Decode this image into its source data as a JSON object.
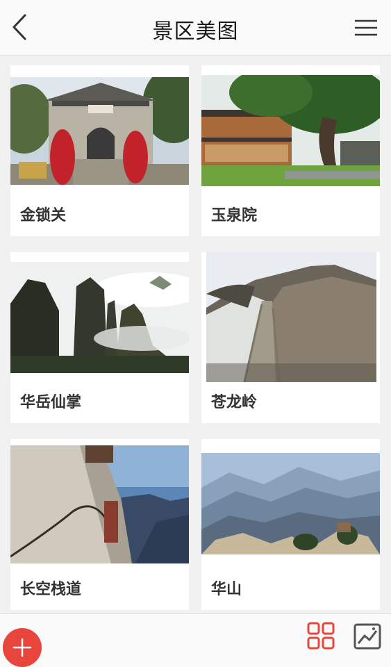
{
  "header": {
    "title": "景区美图",
    "back_icon": "chevron-left-icon",
    "menu_icon": "hamburger-menu-icon"
  },
  "gallery": {
    "items": [
      {
        "label": "金锁关",
        "image": "stone-gate-temple"
      },
      {
        "label": "玉泉院",
        "image": "temple-courtyard-with-pine"
      },
      {
        "label": "华岳仙掌",
        "image": "misty-mountain-peaks"
      },
      {
        "label": "苍龙岭",
        "image": "cliff-stone-stairway"
      },
      {
        "label": "长空栈道",
        "image": "cliffside-plank-walkway"
      },
      {
        "label": "华山",
        "image": "mountain-range-vista"
      }
    ]
  },
  "footer": {
    "add_icon": "plus-icon",
    "grid_view_icon": "grid-view-icon",
    "gallery_icon": "image-gallery-icon"
  },
  "colors": {
    "accent": "#e8453c",
    "background": "#f1f1f1",
    "card": "#ffffff",
    "text": "#333333"
  }
}
